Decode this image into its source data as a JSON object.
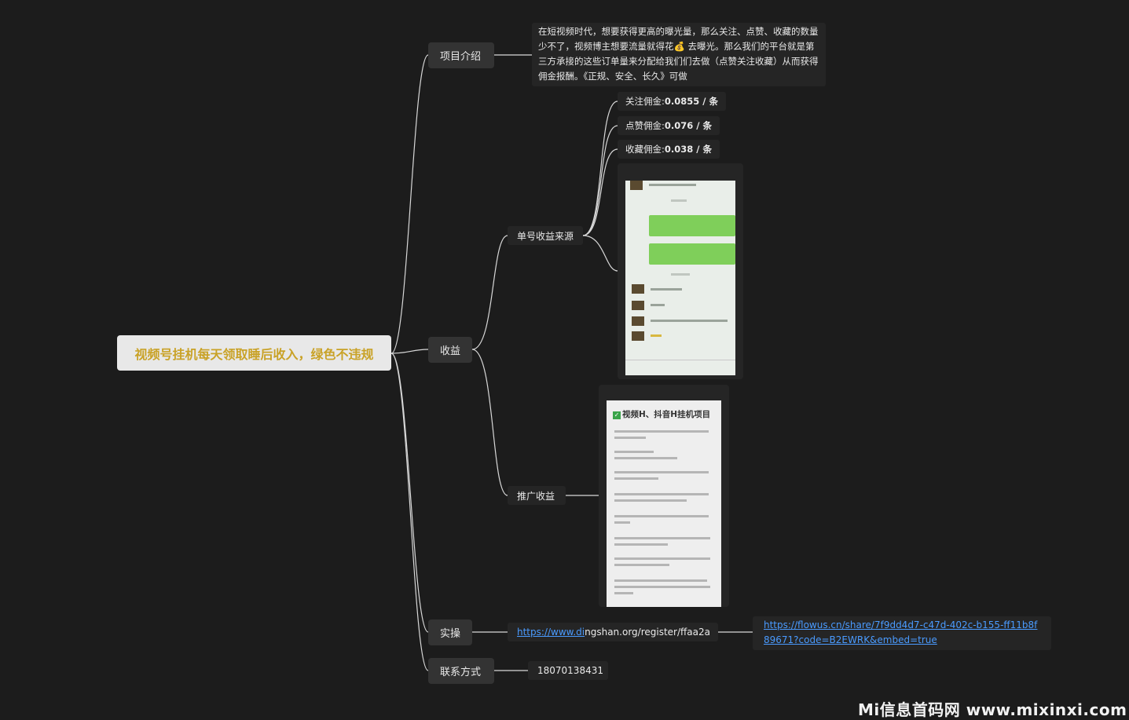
{
  "root": {
    "title": "视频号挂机每天领取睡后收入，绿色不违规"
  },
  "branches": {
    "intro": {
      "label": "项目介绍",
      "description": "在短视频时代，想要获得更高的曝光量，那么关注、点赞、收藏的数量少不了，视频博主想要流量就得花💰 去曝光。那么我们的平台就是第三方承接的这些订单量来分配给我们们去做（点赞关注收藏）从而获得佣金报酬。《正规、安全、长久》可做"
    },
    "income": {
      "label": "收益",
      "single": {
        "label": "单号收益来源",
        "prices": [
          {
            "prefix": "关注佣金:",
            "value": "0.0855 / 条"
          },
          {
            "prefix": "点赞佣金:",
            "value": "0.076 / 条"
          },
          {
            "prefix": "收藏佣金:",
            "value": "0.038 / 条"
          }
        ]
      },
      "promo": {
        "label": "推广收益",
        "poster_title": "视频H、抖音H挂机项目"
      }
    },
    "practice": {
      "label": "实操",
      "url": "https://www.dingshan.org/register/ffaa2a",
      "url_linked": "https://www.di",
      "url_rest": "ngshan.org/register/ffaa2a",
      "flowus": "https://flowus.cn/share/7f9dd4d7-c47d-402c-b155-ff11b8f89671?code=B2EWRK&embed=true"
    },
    "contact": {
      "label": "联系方式",
      "phone": "18070138431"
    }
  },
  "watermark": "Mi信息首码网 www.mixinxi.com",
  "colors": {
    "background": "#1c1c1c",
    "root_text": "#c9a227",
    "link": "#4a9bff",
    "node": "#333333"
  }
}
